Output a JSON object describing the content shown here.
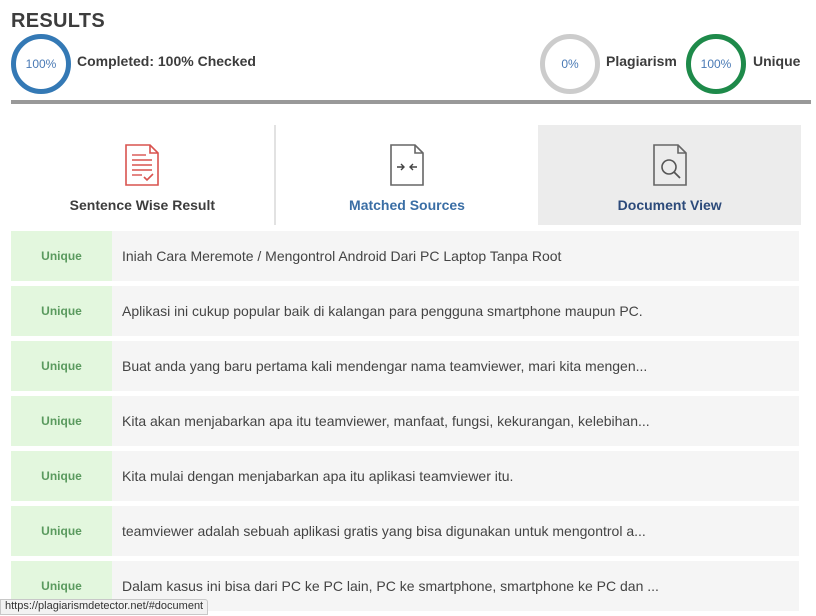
{
  "header": {
    "title": "RESULTS",
    "completed_pct": "100%",
    "completed_label": "Completed: 100% Checked",
    "plagiarism_pct": "0%",
    "plagiarism_label": "Plagiarism",
    "unique_pct": "100%",
    "unique_label": "Unique"
  },
  "tabs": {
    "sentence": "Sentence Wise Result",
    "matched": "Matched Sources",
    "document": "Document View",
    "active": "Document View"
  },
  "rows": [
    {
      "status": "Unique",
      "text": "Iniah Cara Meremote / Mengontrol Android Dari PC Laptop Tanpa Root"
    },
    {
      "status": "Unique",
      "text": "Aplikasi ini cukup popular baik di kalangan para pengguna smartphone maupun PC."
    },
    {
      "status": "Unique",
      "text": "Buat anda yang baru pertama kali mendengar nama teamviewer, mari kita mengen..."
    },
    {
      "status": "Unique",
      "text": "Kita akan menjabarkan apa itu teamviewer, manfaat, fungsi, kekurangan, kelebihan..."
    },
    {
      "status": "Unique",
      "text": "Kita mulai dengan menjabarkan apa itu aplikasi teamviewer itu."
    },
    {
      "status": "Unique",
      "text": "teamviewer adalah sebuah aplikasi gratis yang bisa digunakan untuk mengontrol a..."
    },
    {
      "status": "Unique",
      "text": "Dalam kasus ini bisa dari PC ke PC lain, PC ke smartphone, smartphone ke PC dan ..."
    }
  ],
  "statusbar": {
    "url": "https://plagiarismdetector.net/#document"
  },
  "colors": {
    "completed_ring": "#3479b5",
    "plagiarism_ring": "#cccccc",
    "unique_ring": "#1e8a4a",
    "badge_bg": "#e3f7de",
    "badge_text": "#5a9a5e"
  }
}
